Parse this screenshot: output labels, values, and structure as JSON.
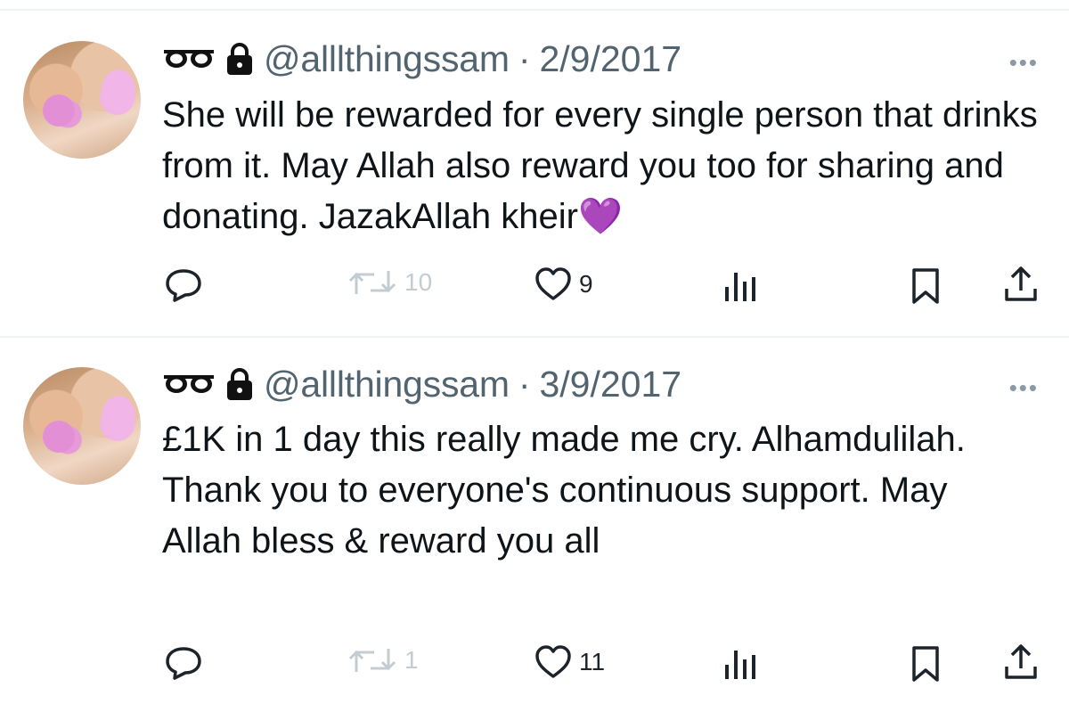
{
  "tweets": [
    {
      "handle": "@alllthingssam",
      "separator": "·",
      "date": "2/9/2017",
      "more": "•••",
      "text": "She will be rewarded for every single person that drinks from it. May Allah also reward you too for sharing and donating. JazakAllah kheir💜",
      "retweets": "10",
      "likes": "9",
      "reply_icon": "reply-icon",
      "retweet_icon": "retweet-icon",
      "like_icon": "heart-icon",
      "views_icon": "analytics-icon",
      "bookmark_icon": "bookmark-icon",
      "share_icon": "share-icon"
    },
    {
      "handle": "@alllthingssam",
      "separator": "·",
      "date": "3/9/2017",
      "more": "•••",
      "text": "£1K in 1 day this really made me cry. Alhamdulilah. Thank you to everyone's continuous support. May Allah bless & reward you all",
      "retweets": "1",
      "likes": "11",
      "reply_icon": "reply-icon",
      "retweet_icon": "retweet-icon",
      "like_icon": "heart-icon",
      "views_icon": "analytics-icon",
      "bookmark_icon": "bookmark-icon",
      "share_icon": "share-icon"
    }
  ],
  "colors": {
    "text": "#0f1419",
    "muted": "#536471",
    "faded": "#c3ccd2",
    "divider": "#eff3f4"
  }
}
